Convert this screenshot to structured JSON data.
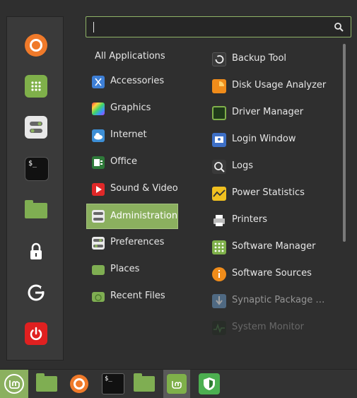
{
  "search": {
    "value": "",
    "placeholder": ""
  },
  "favorites": [
    "firefox-icon",
    "software-manager-icon",
    "settings-icon",
    "terminal-icon",
    "files-icon",
    "lock-screen-icon",
    "logout-icon",
    "shutdown-icon"
  ],
  "categories": [
    {
      "label": "All Applications"
    },
    {
      "label": "Accessories"
    },
    {
      "label": "Graphics"
    },
    {
      "label": "Internet"
    },
    {
      "label": "Office"
    },
    {
      "label": "Sound & Video"
    },
    {
      "label": "Administration"
    },
    {
      "label": "Preferences"
    },
    {
      "label": "Places"
    },
    {
      "label": "Recent Files"
    }
  ],
  "apps": [
    {
      "label": "Backup Tool"
    },
    {
      "label": "Disk Usage Analyzer"
    },
    {
      "label": "Driver Manager"
    },
    {
      "label": "Login Window"
    },
    {
      "label": "Logs"
    },
    {
      "label": "Power Statistics"
    },
    {
      "label": "Printers"
    },
    {
      "label": "Software Manager"
    },
    {
      "label": "Software Sources"
    },
    {
      "label": "Synaptic Package …"
    },
    {
      "label": "System Monitor"
    }
  ],
  "colors": {
    "accent": "#8bb05f",
    "firefox": "#f07a2a",
    "shutdown": "#e02020"
  }
}
